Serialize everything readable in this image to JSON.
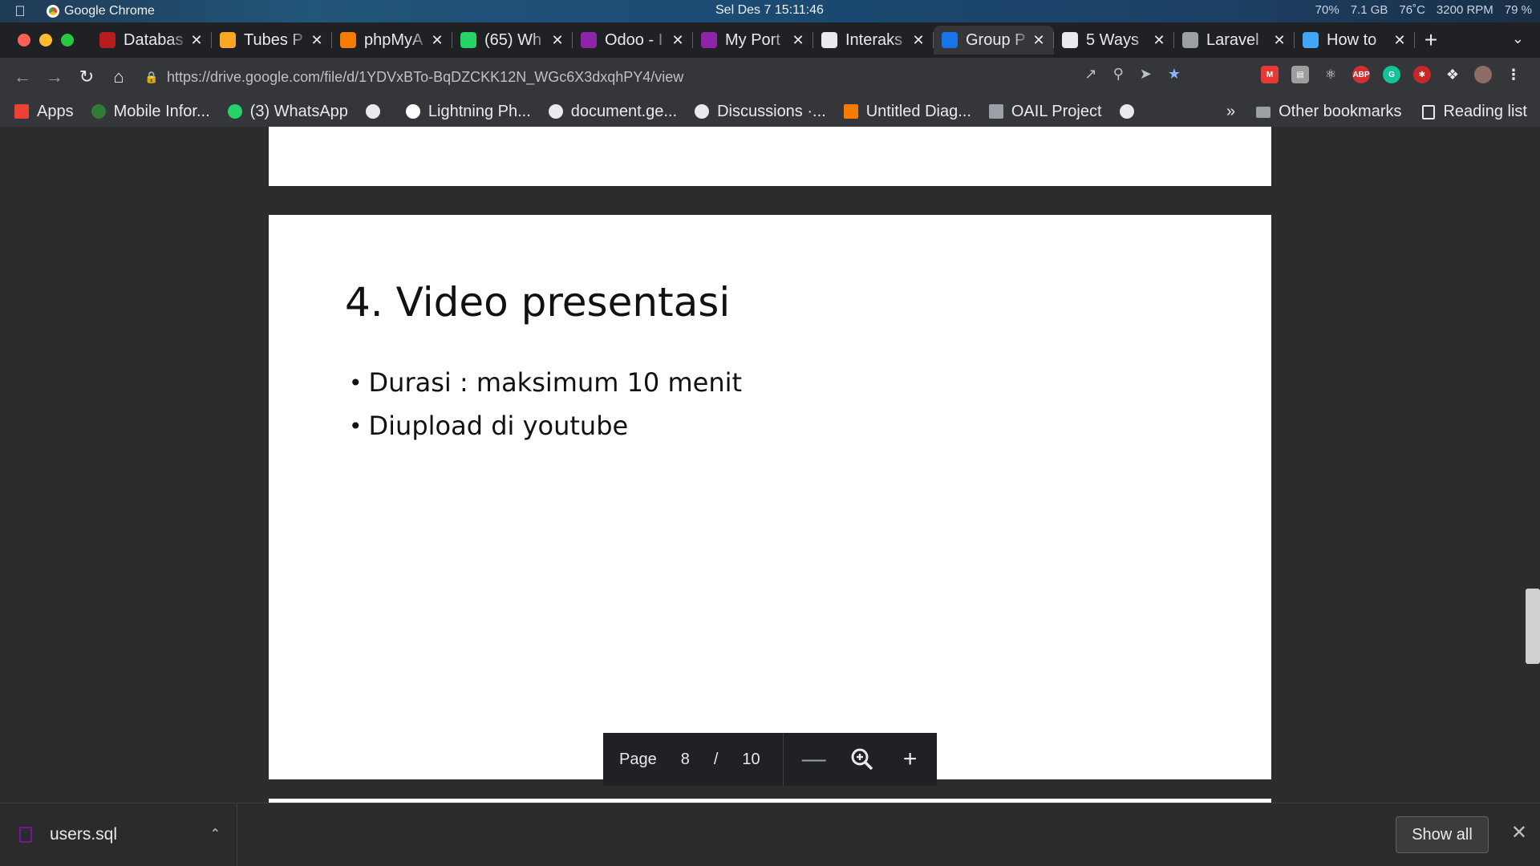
{
  "os_menubar": {
    "app_name": "Google Chrome",
    "clock": "Sel Des 7  15:11:46",
    "status": [
      "70%",
      "7.1 GB",
      "76˚C",
      "3200 RPM",
      "79 %"
    ]
  },
  "tabs": [
    {
      "title": "Databas",
      "icon": "database-icon",
      "color": "#b71c1c"
    },
    {
      "title": "Tubes P",
      "icon": "feather-icon",
      "color": "#f9a825"
    },
    {
      "title": "phpMyA",
      "icon": "phpmyadmin-icon",
      "color": "#f57c00"
    },
    {
      "title": "(65) Wh",
      "icon": "whatsapp-icon",
      "color": "#25d366"
    },
    {
      "title": "Odoo - I",
      "icon": "odoo-icon",
      "color": "#8e24aa"
    },
    {
      "title": "My Port",
      "icon": "odoo-icon",
      "color": "#8e24aa"
    },
    {
      "title": "Interaks",
      "icon": "contact-icon",
      "color": "#e8eaed"
    },
    {
      "title": "Group P",
      "icon": "google-drive-icon",
      "color": "#1a73e8",
      "active": true
    },
    {
      "title": "5 Ways",
      "icon": "people-icon",
      "color": "#e8eaed"
    },
    {
      "title": "Laravel",
      "icon": "laravel-icon",
      "color": "#9aa0a6"
    },
    {
      "title": "How to",
      "icon": "pen-icon",
      "color": "#42a5f5"
    }
  ],
  "toolbar": {
    "url": "https://drive.google.com/file/d/1YDVxBTo-BqDZCKK12N_WGc6X3dxqhPY4/view"
  },
  "bookmarks": [
    {
      "label": "Apps",
      "icon": "apps-grid-icon"
    },
    {
      "label": "Mobile Infor...",
      "icon": "mobile-info-icon"
    },
    {
      "label": "(3) WhatsApp",
      "icon": "whatsapp-icon"
    },
    {
      "label": "",
      "icon": "globe-icon"
    },
    {
      "label": "Lightning Ph...",
      "icon": "google-icon"
    },
    {
      "label": "document.ge...",
      "icon": "globe-icon"
    },
    {
      "label": "Discussions ·...",
      "icon": "globe-icon"
    },
    {
      "label": "Untitled Diag...",
      "icon": "diagram-icon"
    },
    {
      "label": "OAIL Project",
      "icon": "folder-icon"
    },
    {
      "label": "",
      "icon": "globe-icon"
    }
  ],
  "bookmarks_right": {
    "more": "»",
    "other": "Other bookmarks",
    "reading_list": "Reading list"
  },
  "slide": {
    "title": "4. Video presentasi",
    "bullets": [
      "Durasi : maksimum 10 menit",
      "Diupload di youtube"
    ]
  },
  "page_control": {
    "label": "Page",
    "current": "8",
    "separator": "/",
    "total": "10"
  },
  "downloads": {
    "file": "users.sql",
    "show_all": "Show all"
  }
}
